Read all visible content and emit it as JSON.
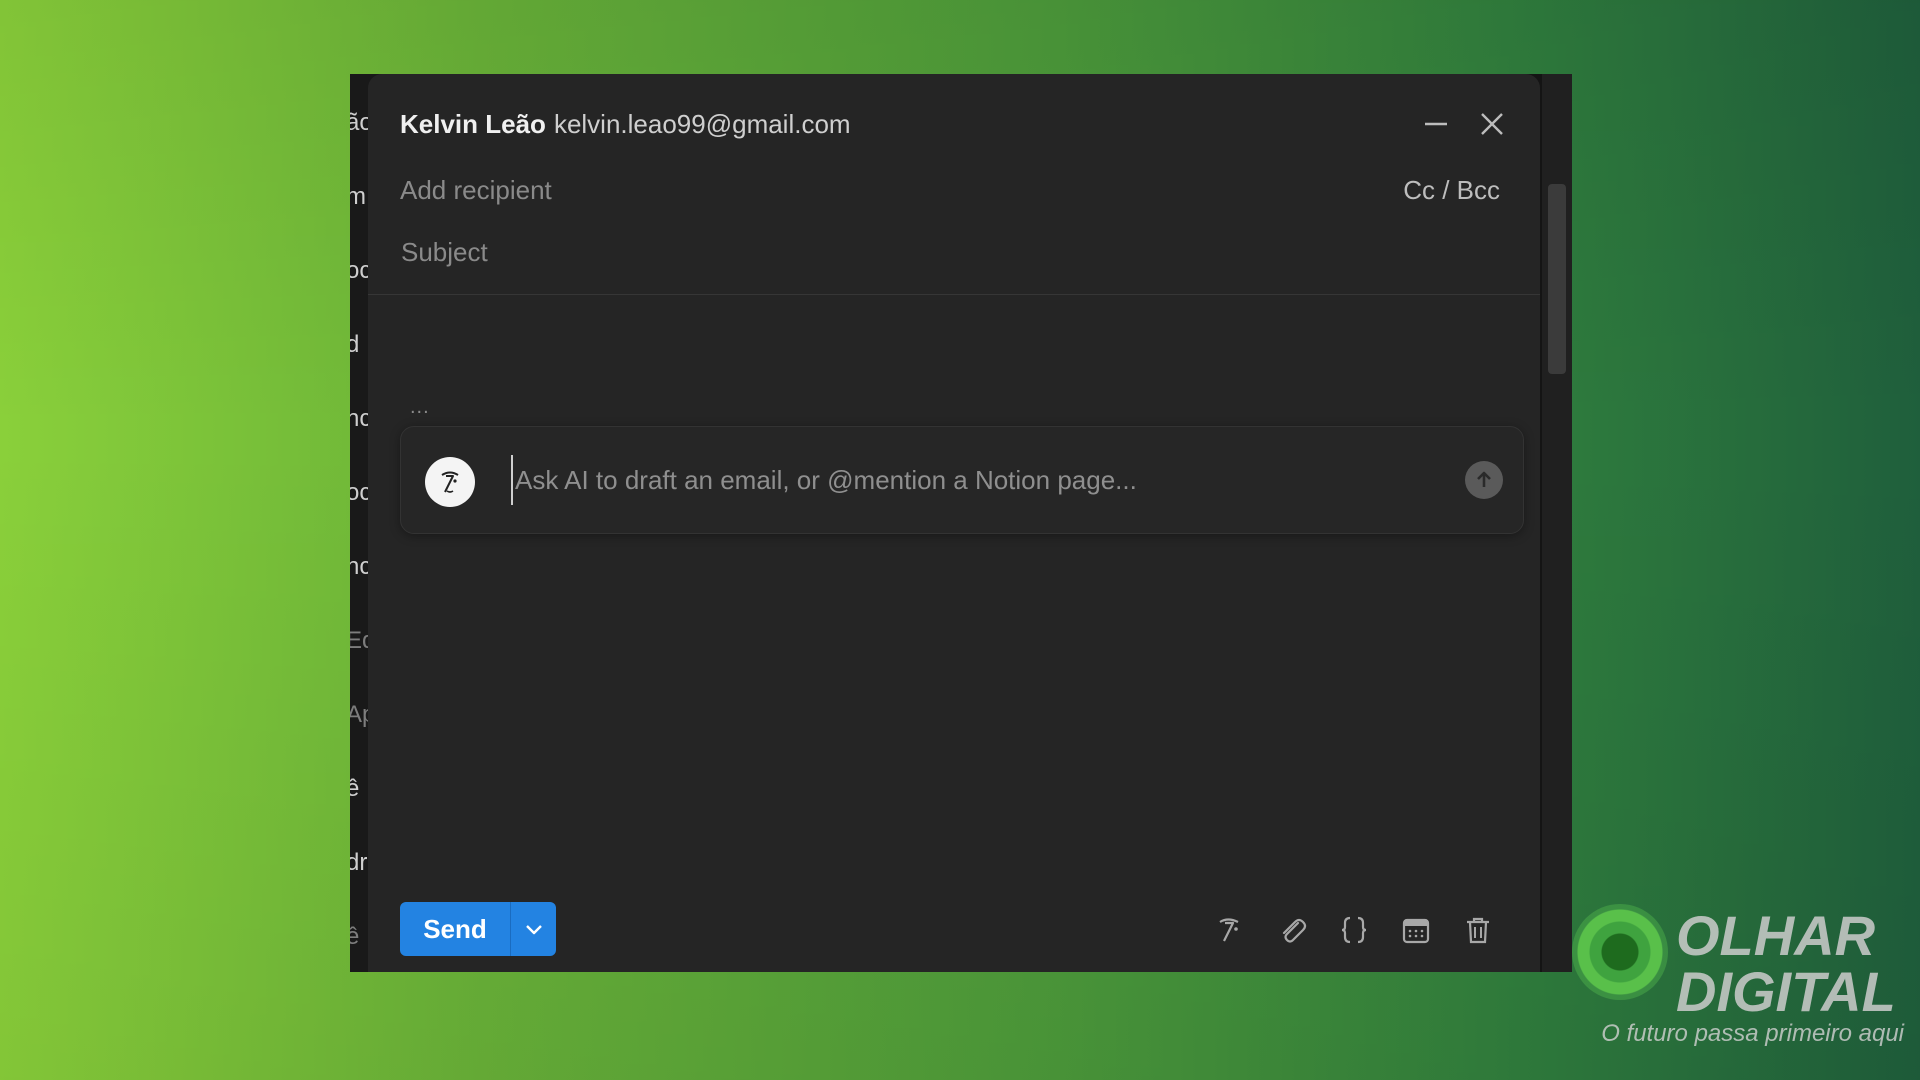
{
  "compose": {
    "from_name": "Kelvin Leão",
    "from_email": "kelvin.leao99@gmail.com",
    "recipient_placeholder": "Add recipient",
    "ccbcc_label": "Cc / Bcc",
    "subject_placeholder": "Subject",
    "dots": "...",
    "ai_prompt_placeholder": "Ask AI to draft an email, or @mention a Notion page...",
    "send_label": "Send"
  },
  "background_sidebar": {
    "items": [
      {
        "text": "ão",
        "dim": false
      },
      {
        "text": "m",
        "dim": false
      },
      {
        "text": "oc",
        "dim": false
      },
      {
        "text": "d",
        "dim": false
      },
      {
        "text": "nc",
        "dim": false
      },
      {
        "text": "oc",
        "dim": false
      },
      {
        "text": "nc",
        "dim": false
      },
      {
        "text": "Ed",
        "dim": true
      },
      {
        "text": "Ap",
        "dim": true
      },
      {
        "text": "ê",
        "dim": false
      },
      {
        "text": "dri",
        "dim": false
      },
      {
        "text": "ê",
        "dim": true
      }
    ]
  },
  "toolbar_icons": [
    "ai-icon",
    "paperclip-icon",
    "braces-icon",
    "calendar-icon",
    "trash-icon"
  ],
  "watermark": {
    "brand": "OLHAR DIGITAL",
    "tagline": "O futuro passa primeiro aqui"
  },
  "colors": {
    "send_button": "#2383e2",
    "modal_bg": "#252525"
  }
}
